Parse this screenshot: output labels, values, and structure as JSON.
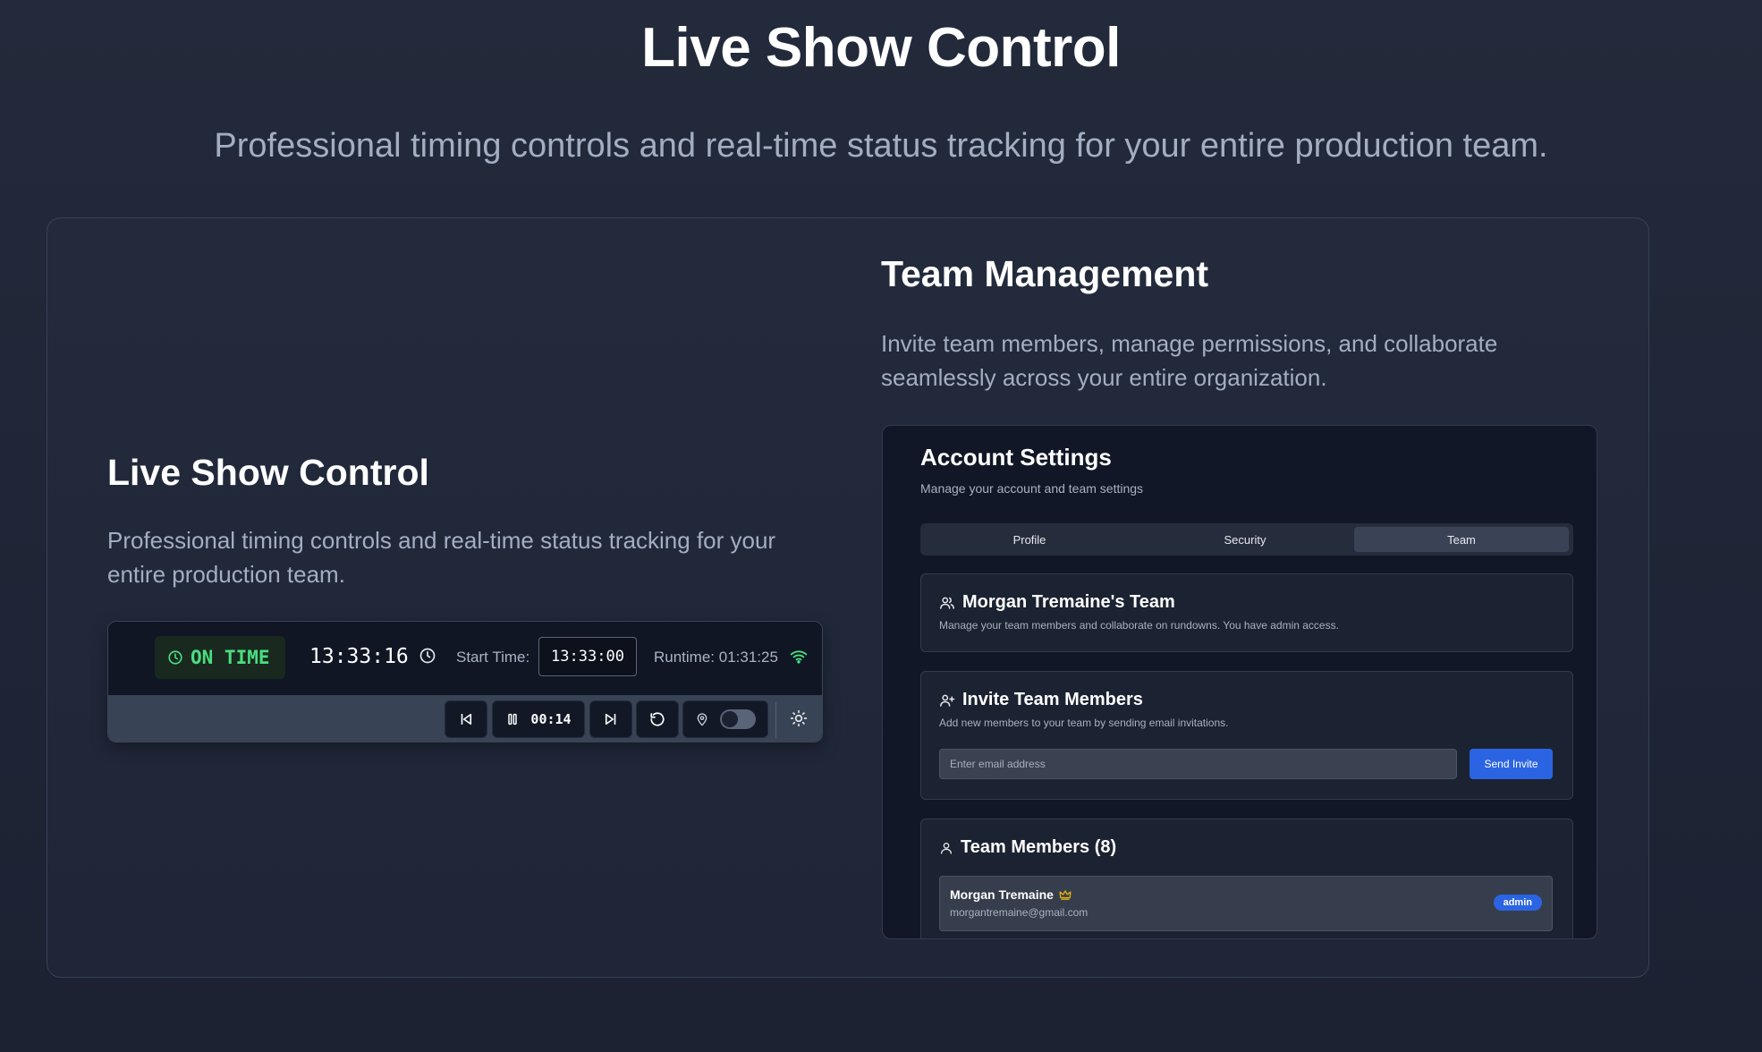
{
  "hero": {
    "title": "Live Show Control",
    "subtitle": "Professional timing controls and real-time status tracking for your entire production team."
  },
  "live_feature": {
    "title": "Live Show Control",
    "description": "Professional timing controls and real-time status tracking for your entire production team.",
    "show_bar": {
      "status": "ON TIME",
      "current_time": "13:33:16",
      "start_time_label": "Start Time:",
      "start_time_value": "13:33:00",
      "runtime_label": "Runtime: 01:31:25",
      "segment_timer": "00:14",
      "icons": {
        "status": "clock-icon",
        "start": "clock-icon",
        "connection": "wifi-icon",
        "prev": "skip-back-icon",
        "pause": "pause-icon",
        "next": "skip-forward-icon",
        "reset": "reset-icon",
        "location": "map-pin-icon",
        "theme": "sun-icon"
      },
      "colors": {
        "on_time": "#4ade80",
        "accent": "#2b64e3"
      }
    }
  },
  "team_feature": {
    "title": "Team Management",
    "description": "Invite team members, manage permissions, and collaborate seamlessly across your entire organization.",
    "settings": {
      "title": "Account Settings",
      "subtitle": "Manage your account and team settings",
      "tabs": [
        {
          "label": "Profile",
          "active": false
        },
        {
          "label": "Security",
          "active": false
        },
        {
          "label": "Team",
          "active": true
        }
      ],
      "team_card": {
        "title": "Morgan Tremaine's Team",
        "description": "Manage your team members and collaborate on rundowns. You have admin access."
      },
      "invite_card": {
        "title": "Invite Team Members",
        "description": "Add new members to your team by sending email invitations.",
        "email_placeholder": "Enter email address",
        "email_value": "",
        "send_label": "Send Invite"
      },
      "members_card": {
        "title": "Team Members (8)",
        "members": [
          {
            "name": "Morgan Tremaine",
            "email": "morgantremaine@gmail.com",
            "role": "admin"
          }
        ]
      }
    }
  }
}
